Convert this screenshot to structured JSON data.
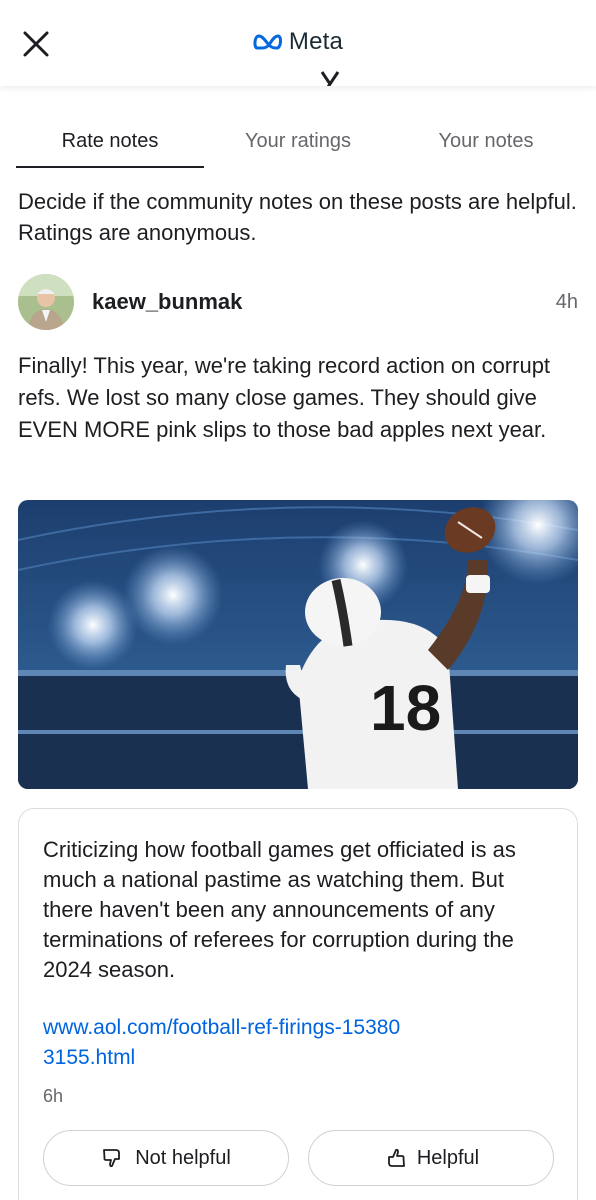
{
  "header": {
    "brand": "Meta",
    "close_icon": "close-icon",
    "brand_icon": "meta-infinity-logo"
  },
  "tabs": [
    {
      "label": "Rate notes",
      "active": true
    },
    {
      "label": "Your ratings",
      "active": false
    },
    {
      "label": "Your notes",
      "active": false
    }
  ],
  "intro": "Decide if the community notes on these posts are helpful. Ratings are anonymous.",
  "post": {
    "username": "kaew_bunmak",
    "time": "4h",
    "text": "Finally! This year, we're taking record action on corrupt refs. We lost so many close games. They should give EVEN MORE pink slips to those bad apples next year.",
    "jersey_number": "18"
  },
  "note": {
    "text": "Criticizing how football games get officiated is as much a national pastime as watching them. But there haven't been any announcements of any terminations of referees for corruption during the 2024 season.",
    "link": "www.aol.com/football-ref-firings-153803155.html",
    "time": "6h",
    "not_helpful_label": "Not helpful",
    "helpful_label": "Helpful"
  },
  "colors": {
    "accent_link": "#0064e0",
    "meta_blue": "#0668e1",
    "secondary_text": "#65676b"
  }
}
